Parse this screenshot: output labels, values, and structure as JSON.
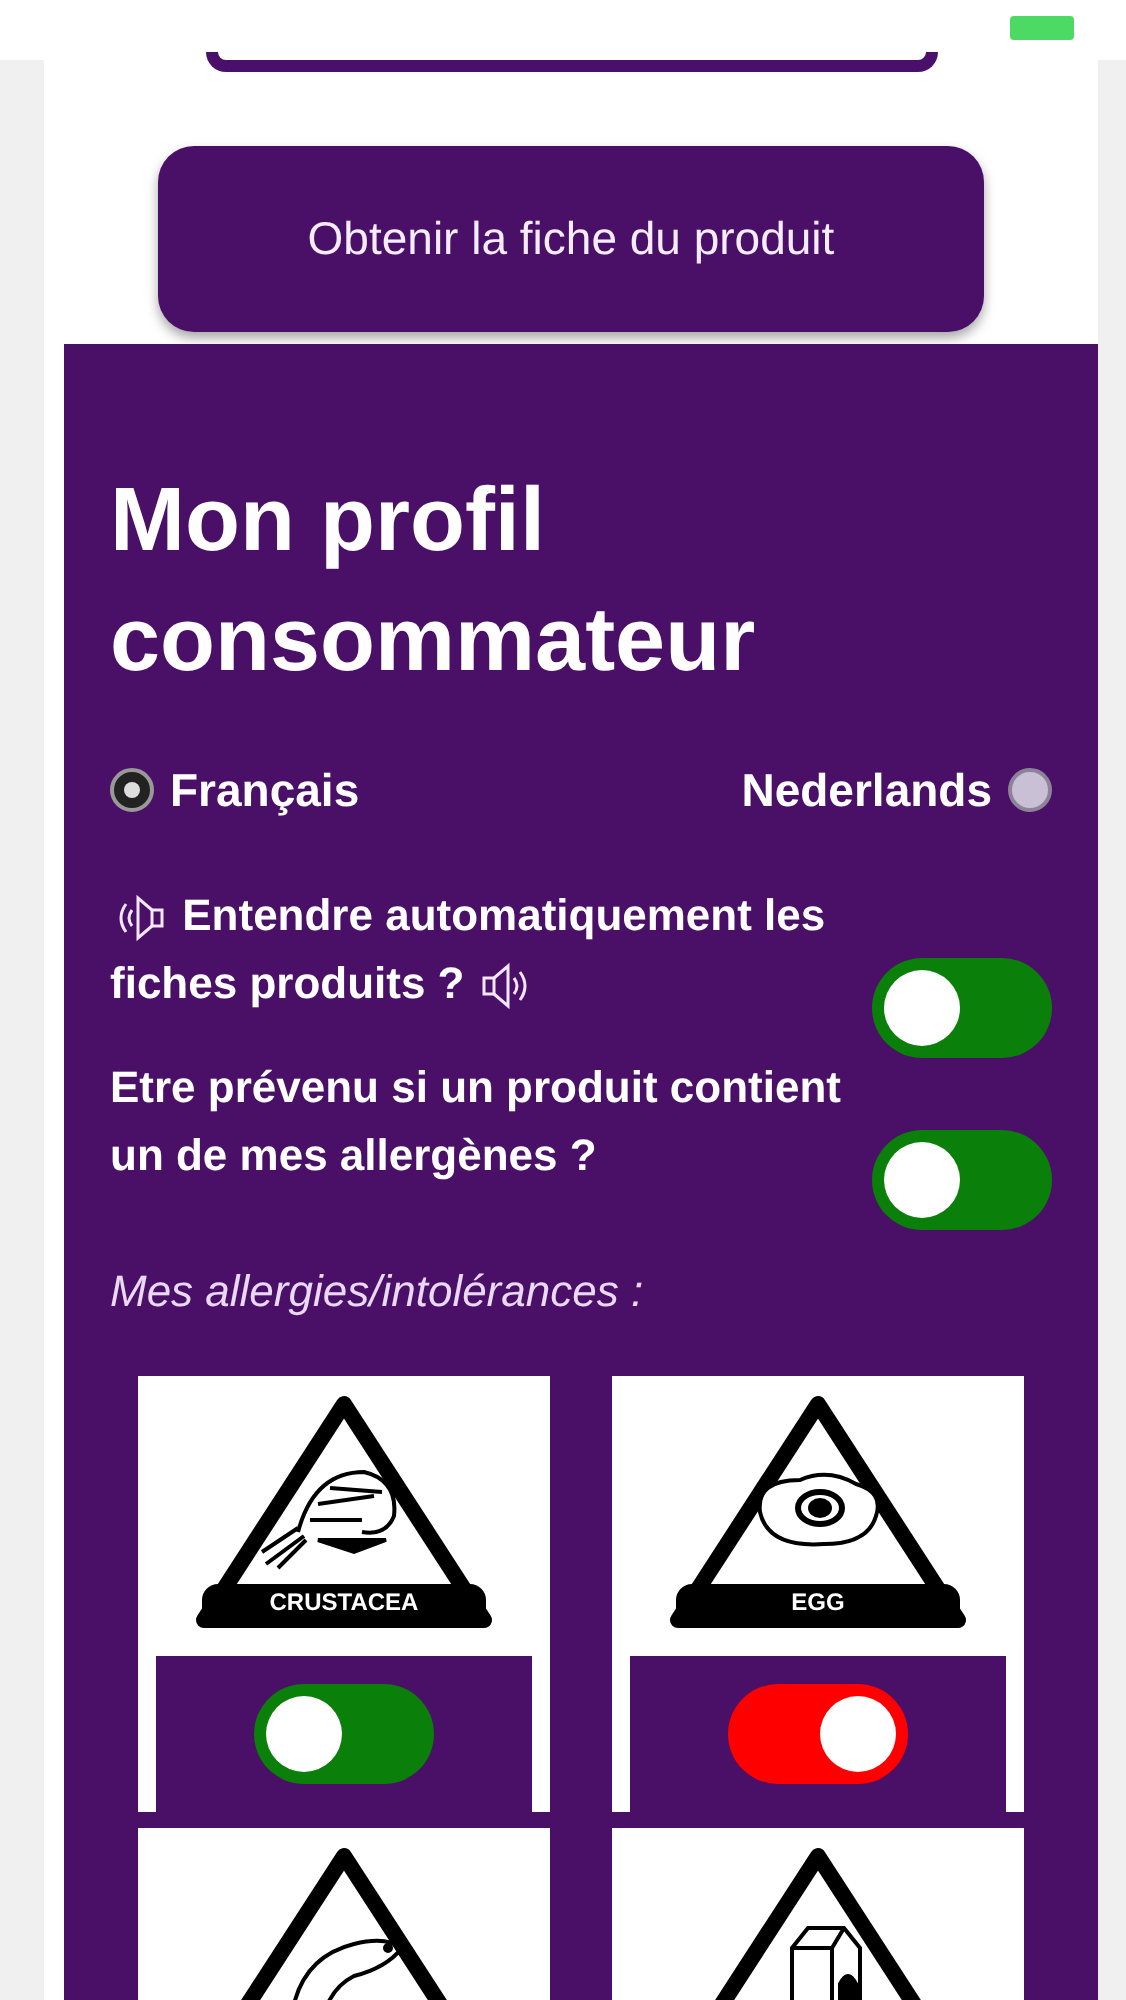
{
  "action_button": {
    "label": "Obtenir la fiche du produit"
  },
  "profile": {
    "title": "Mon profil consommateur",
    "languages": [
      {
        "label": "Français",
        "selected": true
      },
      {
        "label": "Nederlands",
        "selected": false
      }
    ],
    "settings": [
      {
        "label": "Entendre automatiquement les fiches produits ?",
        "audio_icons": true,
        "on": false
      },
      {
        "label": "Etre prévenu si un produit contient un de mes allergènes ?",
        "audio_icons": false,
        "on": false
      }
    ],
    "allergies_heading": "Mes allergies/intolérances :",
    "allergens": [
      {
        "kind": "crustacea",
        "label": "CRUSTACEA",
        "on": false
      },
      {
        "kind": "egg",
        "label": "EGG",
        "on": true
      },
      {
        "kind": "fish"
      },
      {
        "kind": "milk"
      }
    ]
  }
}
